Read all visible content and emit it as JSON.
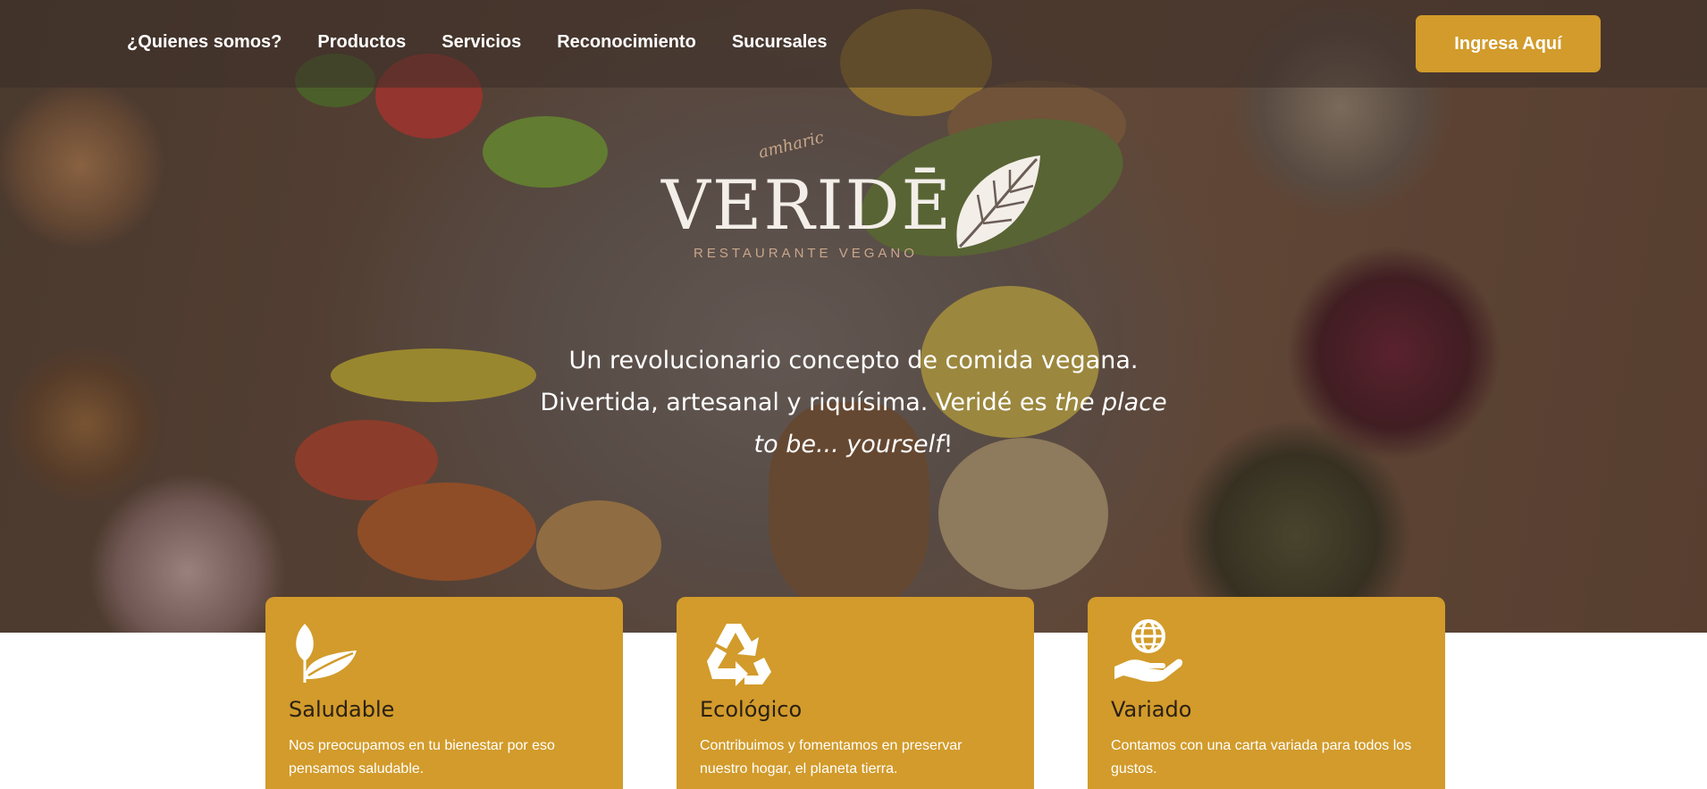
{
  "nav": {
    "items": [
      {
        "label": "¿Quienes somos?"
      },
      {
        "label": "Productos"
      },
      {
        "label": "Servicios"
      },
      {
        "label": "Reconocimiento"
      },
      {
        "label": "Sucursales"
      }
    ],
    "login_label": "Ingresa Aquí"
  },
  "logo": {
    "script": "amharic",
    "brand": "VERIDĒ",
    "tagline": "RESTAURANTE VEGANO"
  },
  "hero": {
    "line1": "Un revolucionario concepto de comida vegana.",
    "line2_plain": "Divertida, artesanal y riquísima. Veridé es ",
    "line2_italic": "the place to be... yourself",
    "line2_end": "!"
  },
  "features": [
    {
      "icon": "leaf-icon",
      "title": "Saludable",
      "text": "Nos preocupamos en tu bienestar por eso pensamos saludable."
    },
    {
      "icon": "recycle-icon",
      "title": "Ecológico",
      "text": "Contribuimos y fomentamos en preservar nuestro hogar, el planeta tierra."
    },
    {
      "icon": "globe-hand-icon",
      "title": "Variado",
      "text": "Contamos con una carta variada para todos los gustos."
    }
  ],
  "colors": {
    "accent": "#d29b2b",
    "card_title": "#2b2013"
  }
}
